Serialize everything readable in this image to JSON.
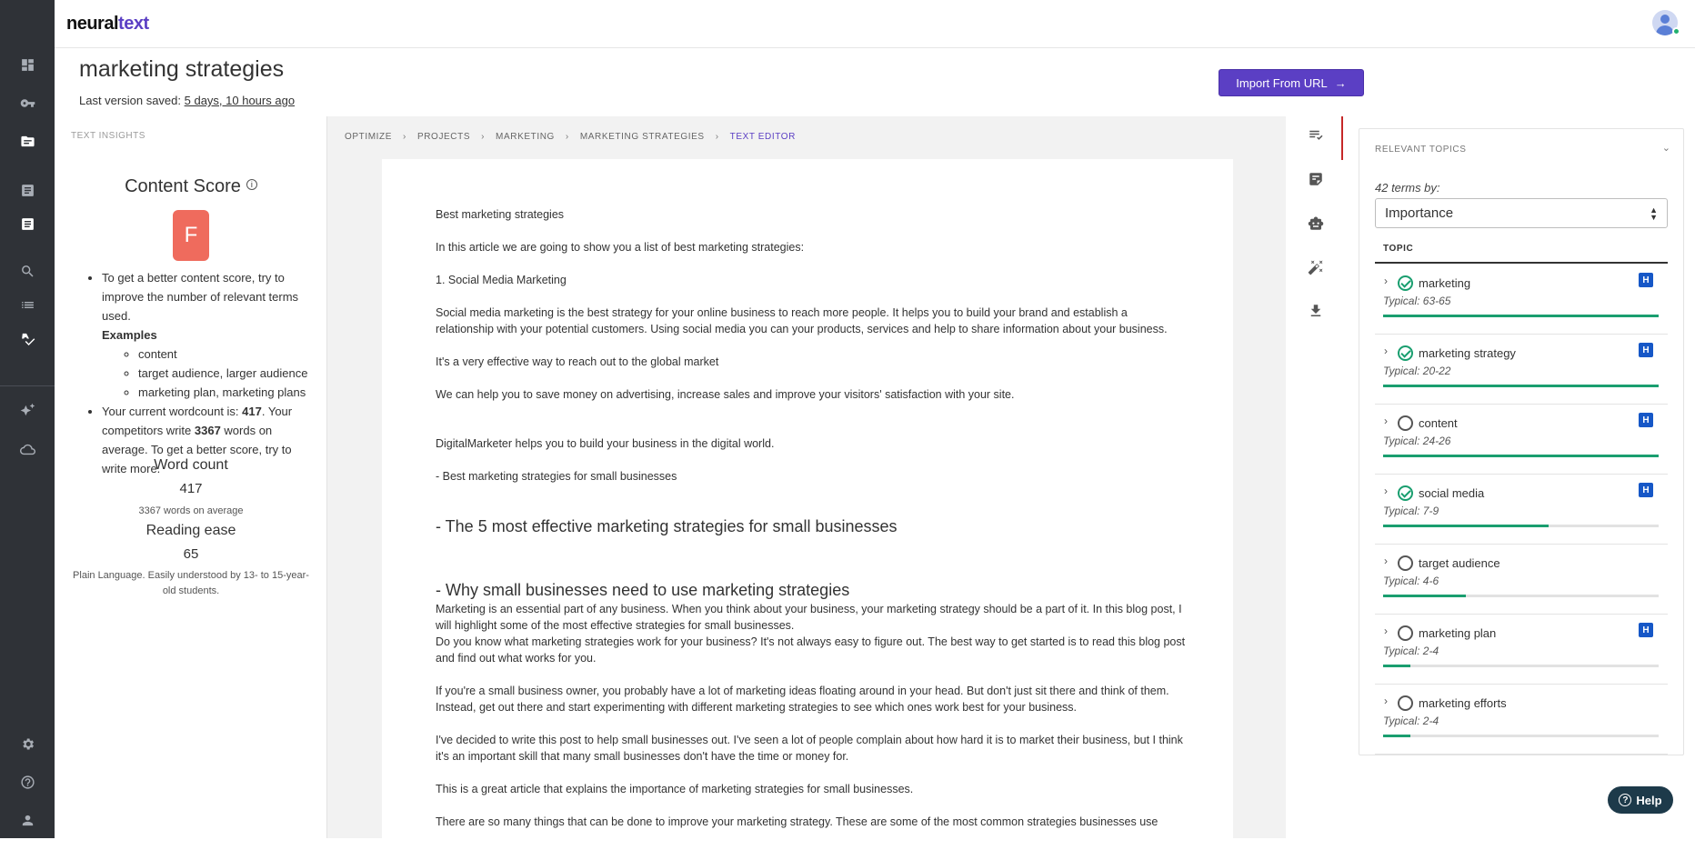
{
  "app": {
    "logo_main": "neural",
    "logo_accent": "text"
  },
  "page": {
    "title": "marketing strategies",
    "saved_prefix": "Last version saved: ",
    "saved_link": "5 days, 10 hours ago",
    "import_label": "Import From URL"
  },
  "insights": {
    "label": "TEXT INSIGHTS",
    "score_title": "Content Score",
    "grade": "F",
    "tip1": "To get a better content score, try to improve the number of relevant terms used.",
    "examples_label": "Examples",
    "examples": [
      "content",
      "target audience, larger audience",
      "marketing plan, marketing plans"
    ],
    "wc_prefix": "Your current wordcount is: ",
    "wc_value": "417",
    "wc_mid": ". Your competitors write ",
    "wc_comp": "3367",
    "wc_suffix": " words on average. To get a better score, try to write more.",
    "word_count_title": "Word count",
    "word_count_value": "417",
    "word_count_sub": "3367 words on average",
    "reading_title": "Reading ease",
    "reading_value": "65",
    "reading_sub": "Plain Language. Easily understood by 13- to 15-year-old students."
  },
  "breadcrumbs": [
    "OPTIMIZE",
    "PROJECTS",
    "MARKETING",
    "MARKETING STRATEGIES",
    "TEXT EDITOR"
  ],
  "document": {
    "p1": "Best marketing strategies",
    "p2": "In this article we are going to show you a list of best marketing strategies:",
    "p3": "1. Social Media Marketing",
    "p4": "Social media marketing is the best strategy for your online business to reach more people. It helps you to build your brand and establish a relationship with your potential customers. Using social media you can your products, services and help to share information about your business.",
    "p5": "It's a very effective way to reach out to the global market",
    "p6": "We can help you to save money on advertising, increase sales and improve your visitors' satisfaction with your site.",
    "p7": "DigitalMarketer helps you to build your business in the digital world.",
    "p8": "- Best marketing strategies for small businesses",
    "h1": "- The 5 most effective marketing strategies for small businesses",
    "h2": "- Why small businesses need to use marketing strategies",
    "p9": "Marketing is an essential part of any business. When you think about your business, your marketing strategy should be a part of it. In this blog post, I will highlight some of the most effective strategies for small businesses.",
    "p10": "Do you know what marketing strategies work for your business? It's not always easy to figure out. The best way to get started is to read this blog post and find out what works for you.",
    "p11": "If you're a small business owner, you probably have a lot of marketing ideas floating around in your head. But don't just sit there and think of them. Instead, get out there and start experimenting with different marketing strategies to see which ones work best for your business.",
    "p12": "I've decided to write this post to help small businesses out. I've seen a lot of people complain about how hard it is to market their business, but I think it's an important skill that many small businesses don't have the time or money for.",
    "p13": "This is a great article that explains the importance of marketing strategies for small businesses.",
    "p14": "There are so many things that can be done to improve your marketing strategy. These are some of the most common strategies businesses use"
  },
  "topics": {
    "header": "RELEVANT TOPICS",
    "terms_by": "42 terms by:",
    "sort_value": "Importance",
    "column": "TOPIC",
    "items": [
      {
        "name": "marketing",
        "typical": "Typical: 63-65",
        "done": true,
        "h": true,
        "progress": 1.0
      },
      {
        "name": "marketing strategy",
        "typical": "Typical: 20-22",
        "done": true,
        "h": true,
        "progress": 1.0
      },
      {
        "name": "content",
        "typical": "Typical: 24-26",
        "done": false,
        "h": true,
        "progress": 1.0
      },
      {
        "name": "social media",
        "typical": "Typical: 7-9",
        "done": true,
        "h": true,
        "progress": 0.6
      },
      {
        "name": "target audience",
        "typical": "Typical: 4-6",
        "done": false,
        "h": false,
        "progress": 0.3
      },
      {
        "name": "marketing plan",
        "typical": "Typical: 2-4",
        "done": false,
        "h": true,
        "progress": 0.1
      },
      {
        "name": "marketing efforts",
        "typical": "Typical: 2-4",
        "done": false,
        "h": false,
        "progress": 0.1
      }
    ],
    "h_badge": "H"
  },
  "help": {
    "label": "Help"
  },
  "colors": {
    "accent": "#5b3fc4",
    "success": "#1a9e6f",
    "grade": "#ef6b5d",
    "badge": "#1657c7"
  }
}
